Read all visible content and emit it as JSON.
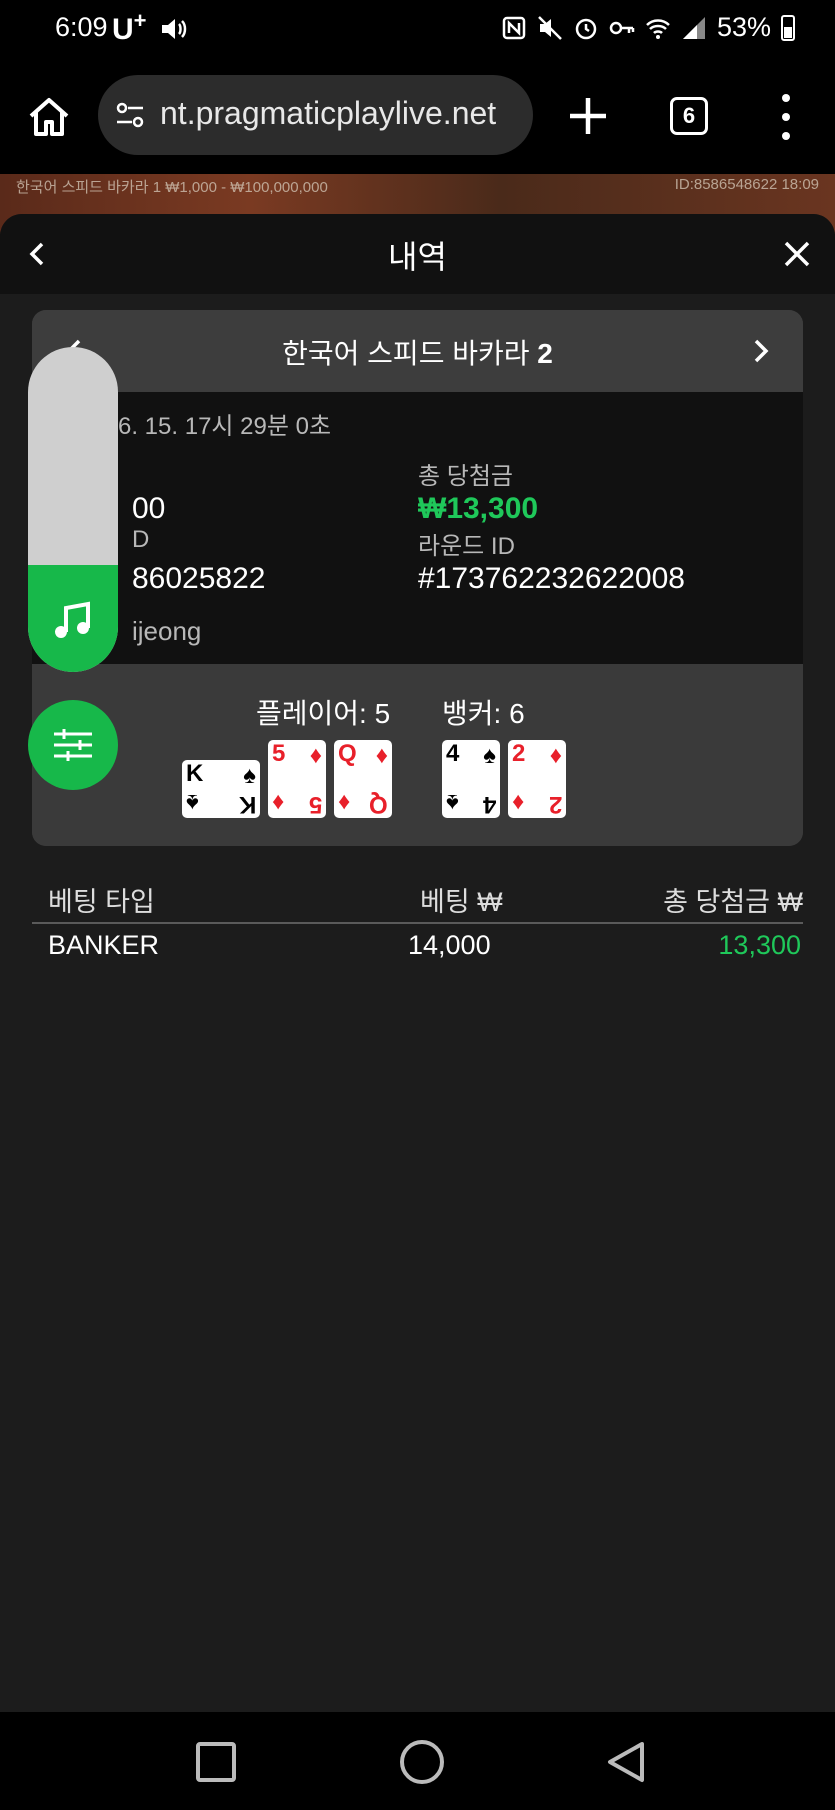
{
  "status_bar": {
    "time": "6:09",
    "carrier": "U",
    "carrier_sup": "+",
    "battery": "53%"
  },
  "browser": {
    "url": "nt.pragmaticplaylive.net",
    "tab_count": "6"
  },
  "game_background": {
    "left_text": "한국어 스피드 바카라 1  ₩1,000 - ₩100,000,000",
    "right_text": "ID:8586548622   18:09"
  },
  "panel": {
    "title": "내역",
    "game_title": "한국어 스피드 바카라",
    "game_number": "2",
    "date": "6. 15. 17시 29분 0초",
    "left_label_1": "",
    "left_value_1": "00",
    "left_label_2": "D",
    "left_value_2": "86025822",
    "total_win_label": "총 당첨금",
    "total_win_value": "₩13,300",
    "round_id_label": "라운드 ID",
    "round_id_value": "#173762232622008",
    "user": "ijeong",
    "player_label": "플레이어: 5",
    "banker_label": "뱅커: 6"
  },
  "player_cards": [
    {
      "rank": "K",
      "suit": "♠",
      "color": "black",
      "sideways": true
    },
    {
      "rank": "5",
      "suit": "♦",
      "color": "red",
      "sideways": false
    },
    {
      "rank": "Q",
      "suit": "♦",
      "color": "red",
      "sideways": false
    }
  ],
  "banker_cards": [
    {
      "rank": "4",
      "suit": "♠",
      "color": "black",
      "sideways": false
    },
    {
      "rank": "2",
      "suit": "♦",
      "color": "red",
      "sideways": false
    }
  ],
  "bets_table": {
    "headers": [
      "베팅 타입",
      "베팅 ₩",
      "총 당첨금 ₩"
    ],
    "rows": [
      {
        "type": "BANKER",
        "bet": "14,000",
        "win": "13,300"
      }
    ]
  },
  "colors": {
    "accent_green": "#17b84a",
    "win_green": "#1fc85a",
    "card_red": "#e8202a"
  },
  "icons": [
    "home-icon",
    "site-settings-icon",
    "plus-icon",
    "tabs-icon",
    "more-vert-icon",
    "back-icon",
    "close-icon",
    "chevron-left-icon",
    "chevron-right-icon",
    "music-note-icon",
    "mixer-icon"
  ],
  "music_volume_fraction": 0.33
}
